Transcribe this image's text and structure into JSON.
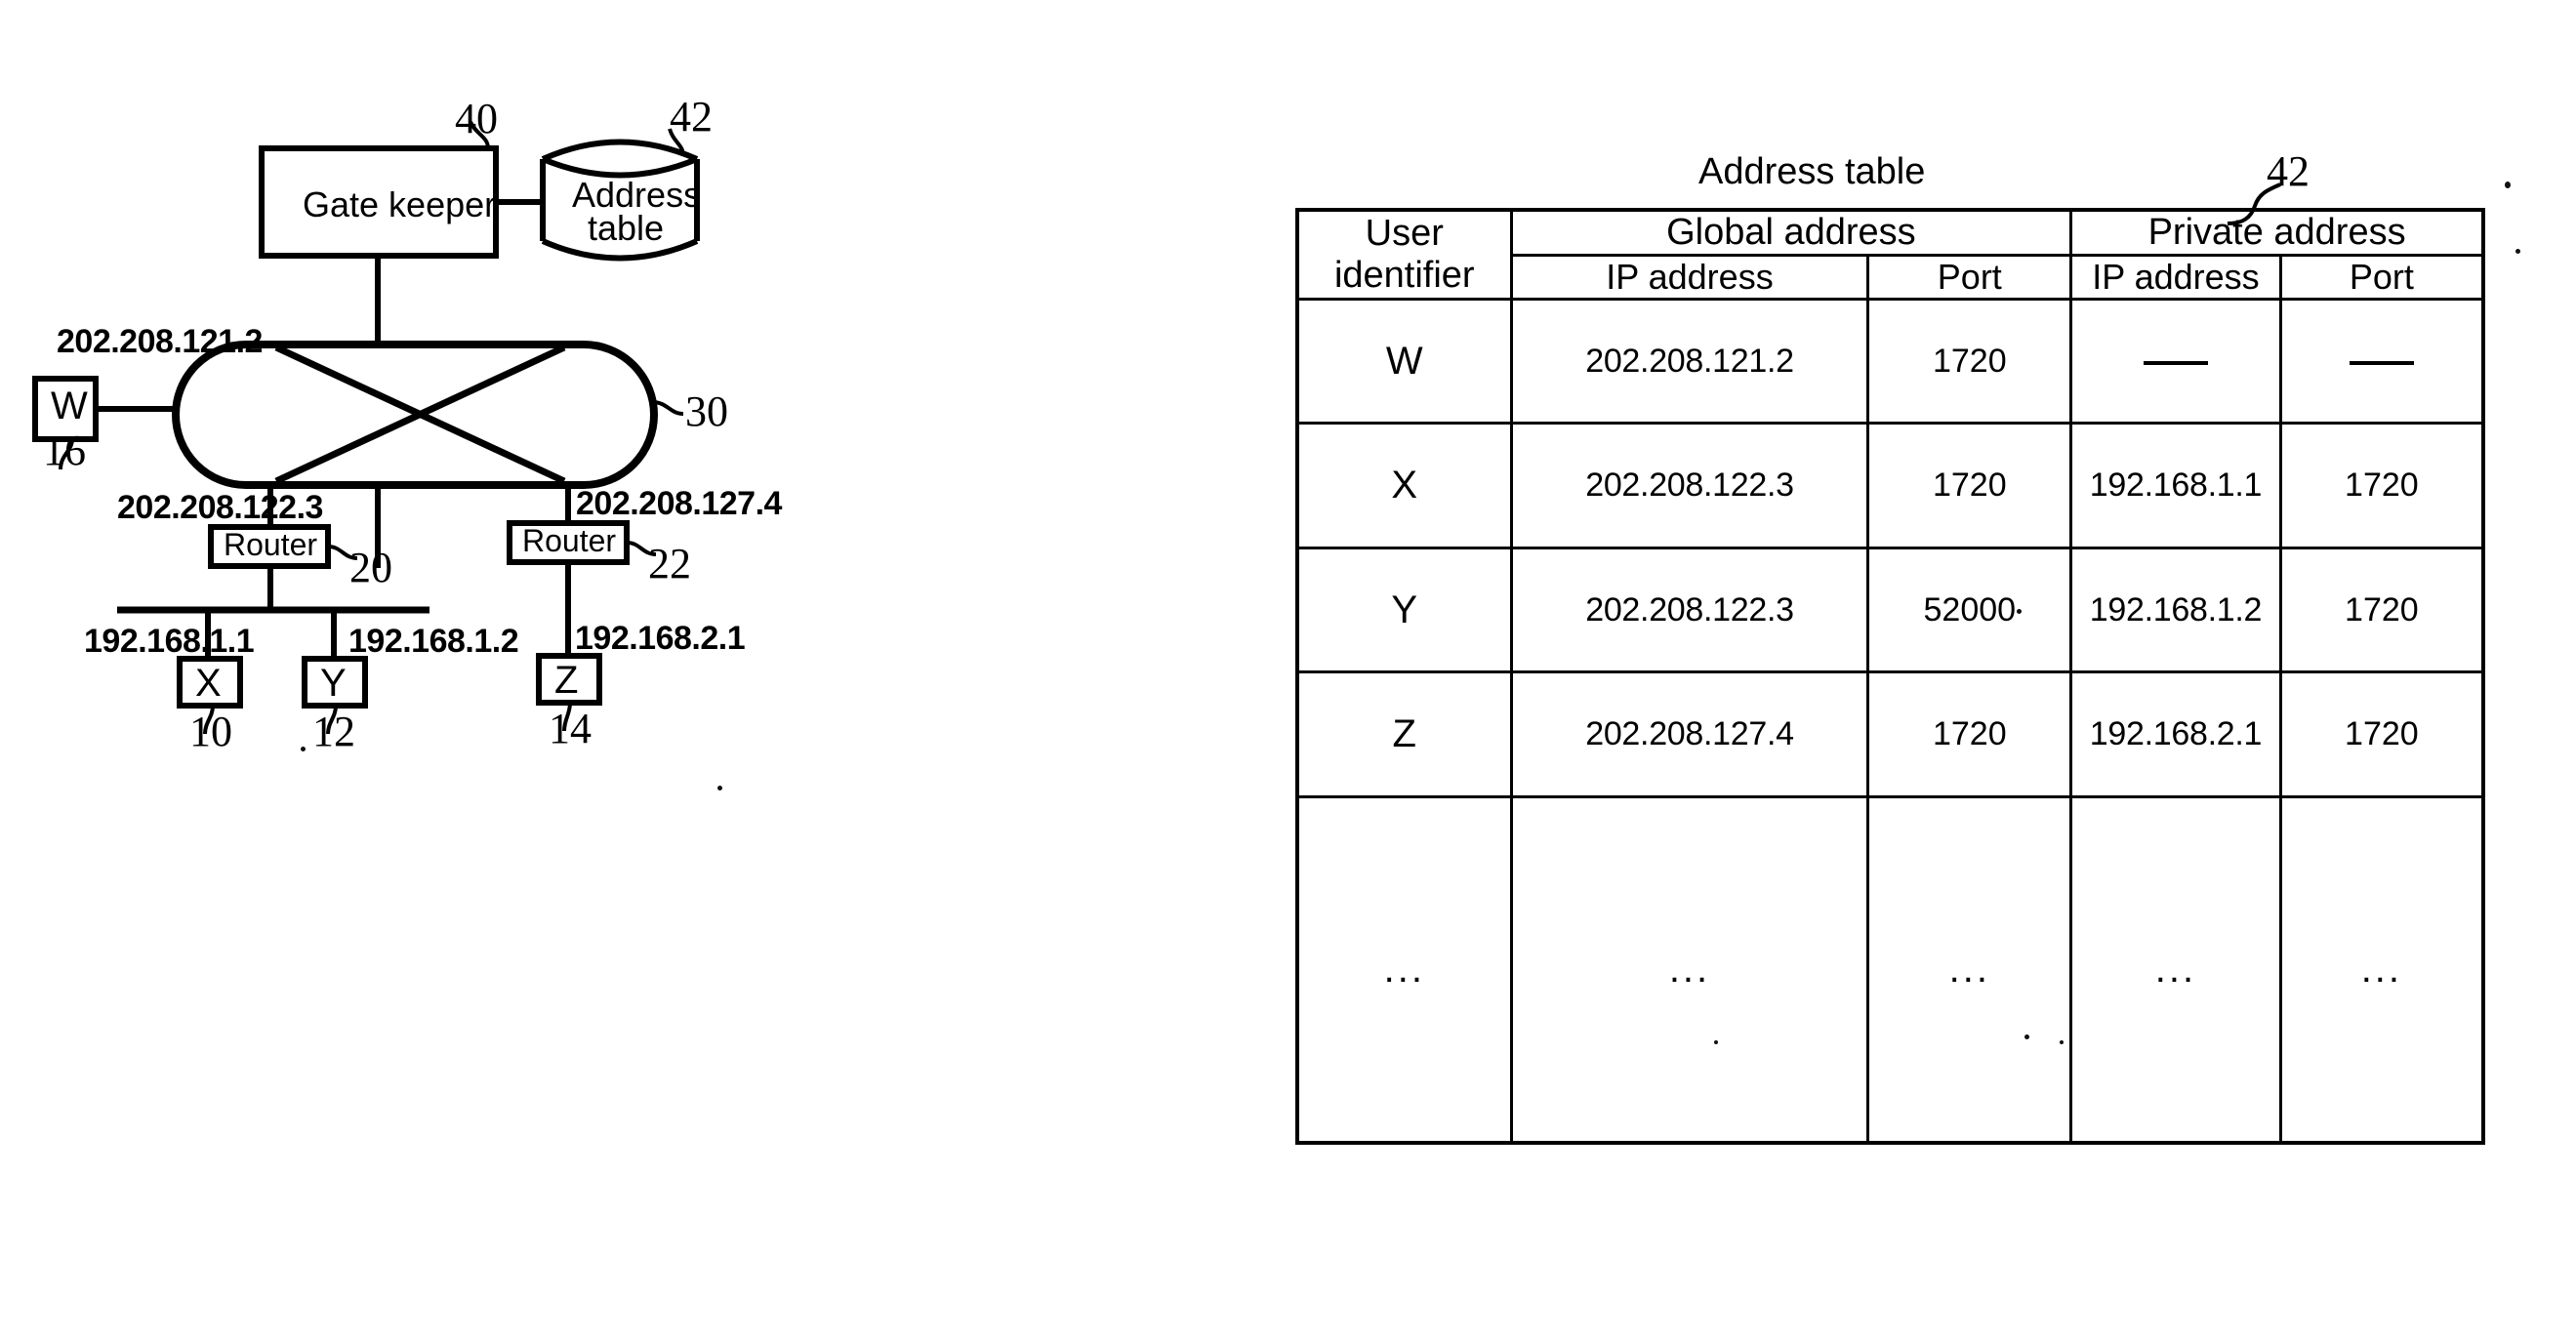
{
  "figure": {
    "gatekeeper": {
      "label": "Gate keeper",
      "ref": "40"
    },
    "address_table_store": {
      "label_line1": "Address",
      "label_line2": "table",
      "ref": "42"
    },
    "network_cloud": {
      "ref": "30"
    },
    "terminal_w": {
      "label": "W",
      "ref": "16",
      "ip": "202.208.121.2"
    },
    "router_left": {
      "label": "Router",
      "ref": "20",
      "ip": "202.208.122.3"
    },
    "router_right": {
      "label": "Router",
      "ref": "22",
      "ip": "202.208.127.4"
    },
    "terminal_x": {
      "label": "X",
      "ref": "10",
      "ip": "192.168.1.1"
    },
    "terminal_y": {
      "label": "Y",
      "ref": "12",
      "ip": "192.168.1.2"
    },
    "terminal_z": {
      "label": "Z",
      "ref": "14",
      "ip": "192.168.2.1"
    }
  },
  "table": {
    "title": "Address table",
    "ref": "42",
    "headers": {
      "user_identifier": "User identifier",
      "user_identifier_line1": "User",
      "user_identifier_line2": "identifier",
      "global_address": "Global address",
      "private_address": "Private address",
      "global_ip": "IP address",
      "global_port": "Port",
      "private_ip": "IP address",
      "private_port": "Port"
    },
    "rows": [
      {
        "user": "W",
        "global_ip": "202.208.121.2",
        "global_port": "1720",
        "private_ip": "—",
        "private_port": "—",
        "private_empty": true
      },
      {
        "user": "X",
        "global_ip": "202.208.122.3",
        "global_port": "1720",
        "private_ip": "192.168.1.1",
        "private_port": "1720",
        "private_empty": false
      },
      {
        "user": "Y",
        "global_ip": "202.208.122.3",
        "global_port": "52000",
        "private_ip": "192.168.1.2",
        "private_port": "1720",
        "private_empty": false
      },
      {
        "user": "Z",
        "global_ip": "202.208.127.4",
        "global_port": "1720",
        "private_ip": "192.168.2.1",
        "private_port": "1720",
        "private_empty": false
      },
      {
        "user": "...",
        "global_ip": "...",
        "global_port": "...",
        "private_ip": "...",
        "private_port": "...",
        "private_empty": false
      }
    ]
  },
  "colors": {
    "ink": "#000000",
    "paper": "#ffffff"
  }
}
